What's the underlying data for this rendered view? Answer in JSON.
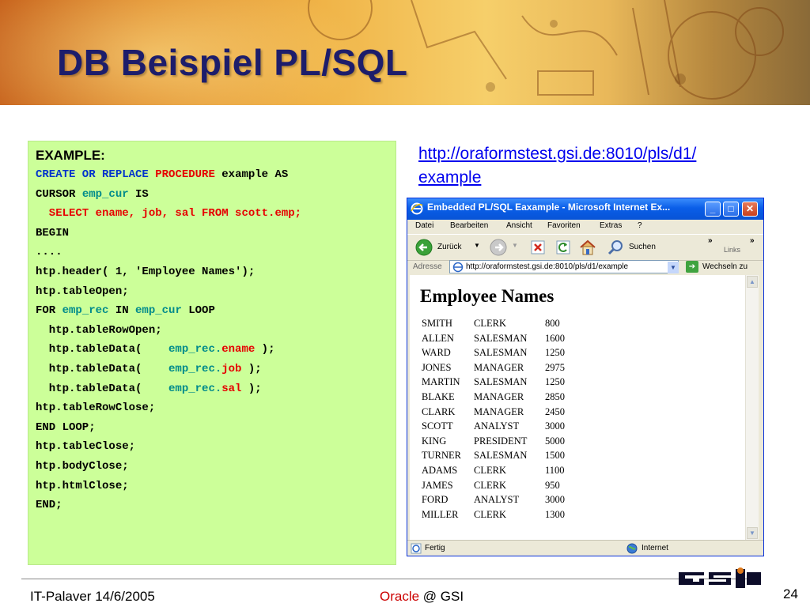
{
  "slide": {
    "title": "DB Beispiel PL/SQL",
    "url_line1": "http://oraformstest.gsi.de:8010/pls/d1/",
    "url_line2": "example"
  },
  "code": {
    "heading": "EXAMPLE:",
    "line1": {
      "a": "CREATE OR REPLACE",
      "b": "PROCEDURE",
      "c": " example AS"
    },
    "line2": {
      "a": "CURSOR ",
      "b": "emp_cur",
      "c": " IS"
    },
    "line3": "  SELECT ename, job, sal FROM scott.emp;",
    "line4": "BEGIN",
    "line5": "....",
    "line6": "htp.header( 1, 'Employee Names');",
    "line7": "htp.tableOpen;",
    "line8": {
      "a": "FOR ",
      "b": "emp_rec",
      "c": " IN ",
      "d": "emp_cur",
      "e": " LOOP"
    },
    "line9": "  htp.tableRowOpen;",
    "line10": {
      "a": "  htp.tableData(    ",
      "b": "emp_rec.",
      "c": "ename",
      "d": " );"
    },
    "line11": {
      "a": "  htp.tableData(    ",
      "b": "emp_rec.",
      "c": "job",
      "d": " );"
    },
    "line12": {
      "a": "  htp.tableData(    ",
      "b": "emp_rec.",
      "c": "sal",
      "d": " );"
    },
    "line13": "htp.tableRowClose;",
    "line14": "END LOOP;",
    "line15": "htp.tableClose;",
    "line16": "htp.bodyClose;",
    "line17": "htp.htmlClose;",
    "line18": "END;"
  },
  "browser": {
    "window_title": "Embedded PL/SQL Eaxample - Microsoft Internet Ex...",
    "menu": [
      "Datei",
      "Bearbeiten",
      "Ansicht",
      "Favoriten",
      "Extras",
      "?"
    ],
    "back_label": "Zurück",
    "search_label": "Suchen",
    "links_label": "Links",
    "address_label": "Adresse",
    "address_value": "http://oraformstest.gsi.de:8010/pls/d1/example",
    "go_label": "Wechseln zu",
    "page_heading": "Employee Names",
    "employees": [
      [
        "SMITH",
        "CLERK",
        "800"
      ],
      [
        "ALLEN",
        "SALESMAN",
        "1600"
      ],
      [
        "WARD",
        "SALESMAN",
        "1250"
      ],
      [
        "JONES",
        "MANAGER",
        "2975"
      ],
      [
        "MARTIN",
        "SALESMAN",
        "1250"
      ],
      [
        "BLAKE",
        "MANAGER",
        "2850"
      ],
      [
        "CLARK",
        "MANAGER",
        "2450"
      ],
      [
        "SCOTT",
        "ANALYST",
        "3000"
      ],
      [
        "KING",
        "PRESIDENT",
        "5000"
      ],
      [
        "TURNER",
        "SALESMAN",
        "1500"
      ],
      [
        "ADAMS",
        "CLERK",
        "1100"
      ],
      [
        "JAMES",
        "CLERK",
        "950"
      ],
      [
        "FORD",
        "ANALYST",
        "3000"
      ],
      [
        "MILLER",
        "CLERK",
        "1300"
      ]
    ],
    "status_left": "Fertig",
    "status_zone": "Internet"
  },
  "footer": {
    "left": "IT-Palaver 14/6/2005",
    "mid_oracle": "Oracle",
    "mid_rest": " @ GSI",
    "page_number": "24"
  },
  "colors": {
    "title": "#1d1d6b",
    "code_bg": "#ccff99",
    "keyword_blue": "#0033cc",
    "keyword_red": "#e60000",
    "identifier_teal": "#008b8b",
    "link": "#0000ee",
    "oracle_red": "#cc0000"
  }
}
